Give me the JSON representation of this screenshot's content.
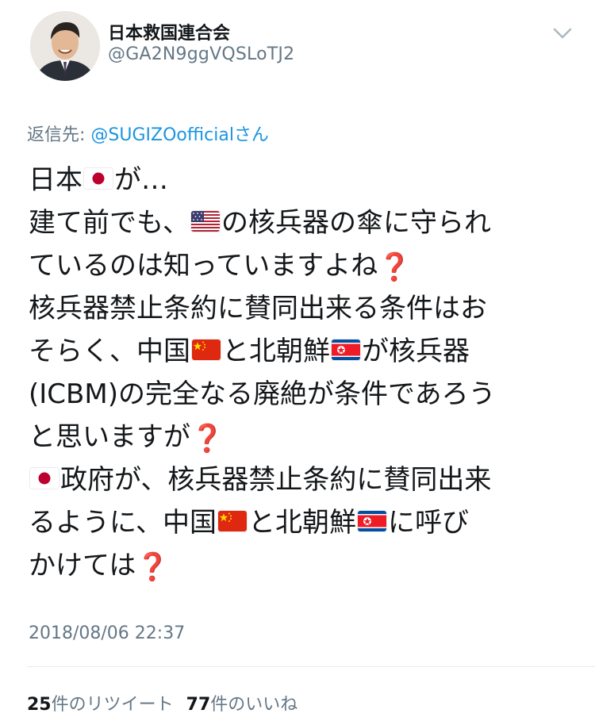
{
  "user": {
    "display_name": "日本救国連合会",
    "handle": "@GA2N9ggVQSLoTJ2"
  },
  "reply": {
    "label": "返信先: ",
    "to_handle": "@SUGIZOofficialさん"
  },
  "tweet": {
    "segments": {
      "s1a": "日本",
      "s1b": "が…",
      "s2a": "建て前でも、",
      "s2b": "の核兵器の傘に守られ",
      "s3a": "ているのは知っていますよね",
      "s3q": "❓",
      "s4": "核兵器禁止条約に賛同出来る条件はお",
      "s5a": "そらく、中国",
      "s5b": "と北朝鮮",
      "s5c": "が核兵器",
      "s6": "(ICBM)の完全なる廃絶が条件であろう",
      "s7a": "と思いますが",
      "s7q": "❓",
      "s8": "政府が、核兵器禁止条約に賛同出来",
      "s9a": "るように、中国",
      "s9b": "と北朝鮮",
      "s9c": "に呼び",
      "s10a": "かけては",
      "s10q": "❓"
    }
  },
  "timestamp": "2018/08/06 22:37",
  "stats": {
    "retweets_count": "25",
    "retweets_label": "件のリツイート",
    "likes_count": "77",
    "likes_label": "件のいいね"
  },
  "icons": {
    "menu": "chevron-down-icon",
    "question": "red-question-mark-icon",
    "flags": [
      "japan-flag-icon",
      "usa-flag-icon",
      "china-flag-icon",
      "north-korea-flag-icon"
    ]
  },
  "colors": {
    "link": "#1b95e0",
    "secondary_text": "#657786",
    "primary_text": "#14171a",
    "question_mark": "#d62f2f"
  }
}
